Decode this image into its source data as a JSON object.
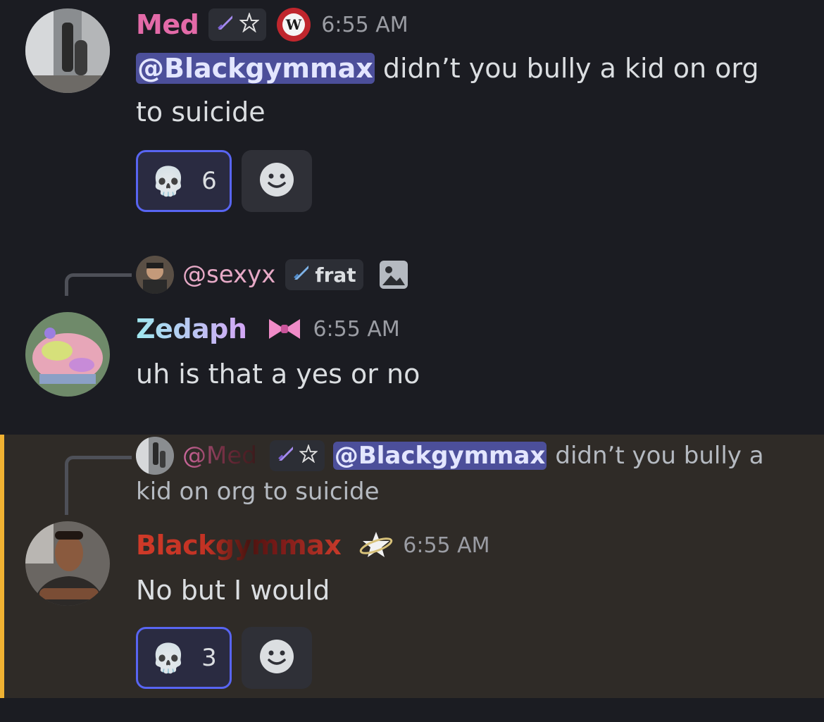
{
  "messages": [
    {
      "username": "Med",
      "username_color": "#e36aa8",
      "timestamp": "6:55 AM",
      "mention": "@Blackgymmax",
      "text_rest": "didn’t you bully a kid on org",
      "text_line2": "to suicide",
      "reaction": {
        "emoji": "💀",
        "count": "6"
      }
    },
    {
      "reply_to": {
        "username": "@sexyx",
        "tag": "frat"
      },
      "username": "Zedaph",
      "username_color": "#b9c6ff",
      "timestamp": "6:55 AM",
      "text": "uh is that a yes or no"
    },
    {
      "reply_to": {
        "username": "@Med",
        "mention": "@Blackgymmax",
        "text_rest": "didn’t you bully a",
        "text_line2": "kid on org to suicide"
      },
      "username": "Blackgymmax",
      "username_color": "#c93a2a",
      "timestamp": "6:55 AM",
      "text": "No but I would",
      "reaction": {
        "emoji": "💀",
        "count": "3"
      }
    }
  ],
  "icons": [
    "sword-icon",
    "pentagram-icon",
    "w-badge-icon",
    "image-icon",
    "bow-icon",
    "star-ring-icon",
    "skull-icon",
    "add-reaction-icon"
  ],
  "colors": {
    "mention_bg": "#4c4f9a",
    "highlight_border": "#f0b232",
    "reaction_border": "#5865f2"
  }
}
